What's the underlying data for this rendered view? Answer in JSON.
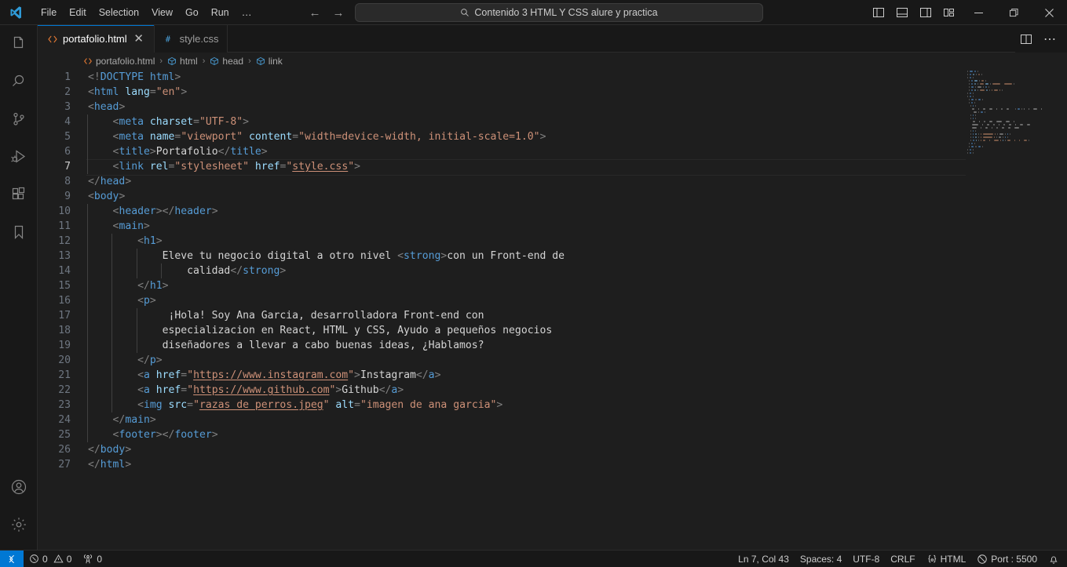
{
  "titlebar": {
    "logo_icon": "vscode-logo-icon",
    "menus": [
      "File",
      "Edit",
      "Selection",
      "View",
      "Go",
      "Run"
    ],
    "overflow_label": "…",
    "nav_back_icon": "arrow-left-icon",
    "nav_forward_icon": "arrow-right-icon",
    "command_center": {
      "search_icon": "search-icon",
      "text": "Contenido 3 HTML Y CSS alure y practica"
    },
    "layout_buttons": [
      {
        "name": "toggle-primary-sidebar-icon"
      },
      {
        "name": "toggle-panel-icon"
      },
      {
        "name": "toggle-secondary-sidebar-icon"
      },
      {
        "name": "customize-layout-icon"
      }
    ],
    "window_controls": [
      {
        "name": "minimize-button",
        "glyph": "─"
      },
      {
        "name": "maximize-button",
        "glyph": "❐"
      },
      {
        "name": "close-button",
        "glyph": "✕"
      }
    ]
  },
  "activitybar": {
    "items": [
      {
        "name": "explorer-icon",
        "label": "Explorer"
      },
      {
        "name": "search-icon",
        "label": "Search"
      },
      {
        "name": "source-control-icon",
        "label": "Source Control"
      },
      {
        "name": "run-and-debug-icon",
        "label": "Run and Debug"
      },
      {
        "name": "extensions-icon",
        "label": "Extensions"
      },
      {
        "name": "bookmarks-icon",
        "label": "Bookmarks"
      }
    ],
    "bottom": [
      {
        "name": "accounts-icon",
        "label": "Accounts"
      },
      {
        "name": "settings-gear-icon",
        "label": "Manage"
      }
    ]
  },
  "tabs": [
    {
      "label": "portafolio.html",
      "icon": "html-file-icon",
      "active": true,
      "close_glyph": "✕"
    },
    {
      "label": "style.css",
      "icon": "css-file-icon",
      "active": false
    }
  ],
  "tabbar_actions": [
    {
      "name": "split-editor-right-icon"
    },
    {
      "name": "more-actions-icon",
      "glyph": "⋯"
    }
  ],
  "breadcrumbs": [
    {
      "label": "portafolio.html",
      "icon": "html-file-icon"
    },
    {
      "label": "html",
      "icon": "symbol-field-icon"
    },
    {
      "label": "head",
      "icon": "symbol-field-icon"
    },
    {
      "label": "link",
      "icon": "symbol-field-icon"
    }
  ],
  "editor": {
    "current_line": 7,
    "first_line_number": 1,
    "lines": [
      {
        "n": 1,
        "indent": 0,
        "tokens": [
          {
            "c": "t-punc",
            "t": "<!"
          },
          {
            "c": "t-doctype",
            "t": "DOCTYPE"
          },
          {
            "c": "t-plain",
            "t": " "
          },
          {
            "c": "t-tag",
            "t": "html"
          },
          {
            "c": "t-punc",
            "t": ">"
          }
        ]
      },
      {
        "n": 2,
        "indent": 0,
        "tokens": [
          {
            "c": "t-punc",
            "t": "<"
          },
          {
            "c": "t-tag",
            "t": "html"
          },
          {
            "c": "t-plain",
            "t": " "
          },
          {
            "c": "t-attr",
            "t": "lang"
          },
          {
            "c": "t-punc",
            "t": "="
          },
          {
            "c": "t-str",
            "t": "\"en\""
          },
          {
            "c": "t-punc",
            "t": ">"
          }
        ]
      },
      {
        "n": 3,
        "indent": 0,
        "tokens": [
          {
            "c": "t-punc",
            "t": "<"
          },
          {
            "c": "t-tag",
            "t": "head"
          },
          {
            "c": "t-punc",
            "t": ">"
          }
        ]
      },
      {
        "n": 4,
        "indent": 1,
        "tokens": [
          {
            "c": "t-plain",
            "t": "    "
          },
          {
            "c": "t-punc",
            "t": "<"
          },
          {
            "c": "t-tag",
            "t": "meta"
          },
          {
            "c": "t-plain",
            "t": " "
          },
          {
            "c": "t-attr",
            "t": "charset"
          },
          {
            "c": "t-punc",
            "t": "="
          },
          {
            "c": "t-str",
            "t": "\"UTF-8\""
          },
          {
            "c": "t-punc",
            "t": ">"
          }
        ]
      },
      {
        "n": 5,
        "indent": 1,
        "tokens": [
          {
            "c": "t-plain",
            "t": "    "
          },
          {
            "c": "t-punc",
            "t": "<"
          },
          {
            "c": "t-tag",
            "t": "meta"
          },
          {
            "c": "t-plain",
            "t": " "
          },
          {
            "c": "t-attr",
            "t": "name"
          },
          {
            "c": "t-punc",
            "t": "="
          },
          {
            "c": "t-str",
            "t": "\"viewport\""
          },
          {
            "c": "t-plain",
            "t": " "
          },
          {
            "c": "t-attr",
            "t": "content"
          },
          {
            "c": "t-punc",
            "t": "="
          },
          {
            "c": "t-str",
            "t": "\"width=device-width, initial-scale=1.0\""
          },
          {
            "c": "t-punc",
            "t": ">"
          }
        ]
      },
      {
        "n": 6,
        "indent": 1,
        "tokens": [
          {
            "c": "t-plain",
            "t": "    "
          },
          {
            "c": "t-punc",
            "t": "<"
          },
          {
            "c": "t-tag",
            "t": "title"
          },
          {
            "c": "t-punc",
            "t": ">"
          },
          {
            "c": "t-plain",
            "t": "Portafolio"
          },
          {
            "c": "t-punc",
            "t": "</"
          },
          {
            "c": "t-tag",
            "t": "title"
          },
          {
            "c": "t-punc",
            "t": ">"
          }
        ]
      },
      {
        "n": 7,
        "indent": 1,
        "tokens": [
          {
            "c": "t-plain",
            "t": "    "
          },
          {
            "c": "t-punc",
            "t": "<"
          },
          {
            "c": "t-tag",
            "t": "link"
          },
          {
            "c": "t-plain",
            "t": " "
          },
          {
            "c": "t-attr",
            "t": "rel"
          },
          {
            "c": "t-punc",
            "t": "="
          },
          {
            "c": "t-str",
            "t": "\"stylesheet\""
          },
          {
            "c": "t-plain",
            "t": " "
          },
          {
            "c": "t-attr",
            "t": "href"
          },
          {
            "c": "t-punc",
            "t": "="
          },
          {
            "c": "t-str",
            "t": "\""
          },
          {
            "c": "t-link",
            "t": "style.css"
          },
          {
            "c": "t-str",
            "t": "\""
          },
          {
            "c": "t-punc",
            "t": ">"
          }
        ]
      },
      {
        "n": 8,
        "indent": 0,
        "tokens": [
          {
            "c": "t-punc",
            "t": "</"
          },
          {
            "c": "t-tag",
            "t": "head"
          },
          {
            "c": "t-punc",
            "t": ">"
          }
        ]
      },
      {
        "n": 9,
        "indent": 0,
        "tokens": [
          {
            "c": "t-punc",
            "t": "<"
          },
          {
            "c": "t-tag",
            "t": "body"
          },
          {
            "c": "t-punc",
            "t": ">"
          }
        ]
      },
      {
        "n": 10,
        "indent": 1,
        "tokens": [
          {
            "c": "t-plain",
            "t": "    "
          },
          {
            "c": "t-punc",
            "t": "<"
          },
          {
            "c": "t-tag",
            "t": "header"
          },
          {
            "c": "t-punc",
            "t": "></"
          },
          {
            "c": "t-tag",
            "t": "header"
          },
          {
            "c": "t-punc",
            "t": ">"
          }
        ]
      },
      {
        "n": 11,
        "indent": 1,
        "tokens": [
          {
            "c": "t-plain",
            "t": "    "
          },
          {
            "c": "t-punc",
            "t": "<"
          },
          {
            "c": "t-tag",
            "t": "main"
          },
          {
            "c": "t-punc",
            "t": ">"
          }
        ]
      },
      {
        "n": 12,
        "indent": 2,
        "tokens": [
          {
            "c": "t-plain",
            "t": "        "
          },
          {
            "c": "t-punc",
            "t": "<"
          },
          {
            "c": "t-tag",
            "t": "h1"
          },
          {
            "c": "t-punc",
            "t": ">"
          }
        ]
      },
      {
        "n": 13,
        "indent": 3,
        "tokens": [
          {
            "c": "t-plain",
            "t": "            Eleve tu negocio digital a otro nivel "
          },
          {
            "c": "t-punc",
            "t": "<"
          },
          {
            "c": "t-tag",
            "t": "strong"
          },
          {
            "c": "t-punc",
            "t": ">"
          },
          {
            "c": "t-plain",
            "t": "con un Front-end de"
          }
        ]
      },
      {
        "n": 14,
        "indent": 4,
        "tokens": [
          {
            "c": "t-plain",
            "t": "                calidad"
          },
          {
            "c": "t-punc",
            "t": "</"
          },
          {
            "c": "t-tag",
            "t": "strong"
          },
          {
            "c": "t-punc",
            "t": ">"
          }
        ]
      },
      {
        "n": 15,
        "indent": 2,
        "tokens": [
          {
            "c": "t-plain",
            "t": "        "
          },
          {
            "c": "t-punc",
            "t": "</"
          },
          {
            "c": "t-tag",
            "t": "h1"
          },
          {
            "c": "t-punc",
            "t": ">"
          }
        ]
      },
      {
        "n": 16,
        "indent": 2,
        "tokens": [
          {
            "c": "t-plain",
            "t": "        "
          },
          {
            "c": "t-punc",
            "t": "<"
          },
          {
            "c": "t-tag",
            "t": "p"
          },
          {
            "c": "t-punc",
            "t": ">"
          }
        ]
      },
      {
        "n": 17,
        "indent": 3,
        "tokens": [
          {
            "c": "t-plain",
            "t": "             ¡Hola! Soy Ana Garcia, desarrolladora Front-end con"
          }
        ]
      },
      {
        "n": 18,
        "indent": 3,
        "tokens": [
          {
            "c": "t-plain",
            "t": "            especializacion en React, HTML y CSS, Ayudo a pequeños negocios"
          }
        ]
      },
      {
        "n": 19,
        "indent": 3,
        "tokens": [
          {
            "c": "t-plain",
            "t": "            diseñadores a llevar a cabo buenas ideas, ¿Hablamos?"
          }
        ]
      },
      {
        "n": 20,
        "indent": 2,
        "tokens": [
          {
            "c": "t-plain",
            "t": "        "
          },
          {
            "c": "t-punc",
            "t": "</"
          },
          {
            "c": "t-tag",
            "t": "p"
          },
          {
            "c": "t-punc",
            "t": ">"
          }
        ]
      },
      {
        "n": 21,
        "indent": 2,
        "tokens": [
          {
            "c": "t-plain",
            "t": "        "
          },
          {
            "c": "t-punc",
            "t": "<"
          },
          {
            "c": "t-tag",
            "t": "a"
          },
          {
            "c": "t-plain",
            "t": " "
          },
          {
            "c": "t-attr",
            "t": "href"
          },
          {
            "c": "t-punc",
            "t": "="
          },
          {
            "c": "t-str",
            "t": "\""
          },
          {
            "c": "t-link",
            "t": "https://www.instagram.com"
          },
          {
            "c": "t-str",
            "t": "\""
          },
          {
            "c": "t-punc",
            "t": ">"
          },
          {
            "c": "t-plain",
            "t": "Instagram"
          },
          {
            "c": "t-punc",
            "t": "</"
          },
          {
            "c": "t-tag",
            "t": "a"
          },
          {
            "c": "t-punc",
            "t": ">"
          }
        ]
      },
      {
        "n": 22,
        "indent": 2,
        "tokens": [
          {
            "c": "t-plain",
            "t": "        "
          },
          {
            "c": "t-punc",
            "t": "<"
          },
          {
            "c": "t-tag",
            "t": "a"
          },
          {
            "c": "t-plain",
            "t": " "
          },
          {
            "c": "t-attr",
            "t": "href"
          },
          {
            "c": "t-punc",
            "t": "="
          },
          {
            "c": "t-str",
            "t": "\""
          },
          {
            "c": "t-link",
            "t": "https://www.github.com"
          },
          {
            "c": "t-str",
            "t": "\""
          },
          {
            "c": "t-punc",
            "t": ">"
          },
          {
            "c": "t-plain",
            "t": "Github"
          },
          {
            "c": "t-punc",
            "t": "</"
          },
          {
            "c": "t-tag",
            "t": "a"
          },
          {
            "c": "t-punc",
            "t": ">"
          }
        ]
      },
      {
        "n": 23,
        "indent": 2,
        "tokens": [
          {
            "c": "t-plain",
            "t": "        "
          },
          {
            "c": "t-punc",
            "t": "<"
          },
          {
            "c": "t-tag",
            "t": "img"
          },
          {
            "c": "t-plain",
            "t": " "
          },
          {
            "c": "t-attr",
            "t": "src"
          },
          {
            "c": "t-punc",
            "t": "="
          },
          {
            "c": "t-str",
            "t": "\""
          },
          {
            "c": "t-link",
            "t": "razas de perros.jpeg"
          },
          {
            "c": "t-str",
            "t": "\""
          },
          {
            "c": "t-plain",
            "t": " "
          },
          {
            "c": "t-attr",
            "t": "alt"
          },
          {
            "c": "t-punc",
            "t": "="
          },
          {
            "c": "t-str",
            "t": "\"imagen de ana garcia\""
          },
          {
            "c": "t-punc",
            "t": ">"
          }
        ]
      },
      {
        "n": 24,
        "indent": 1,
        "tokens": [
          {
            "c": "t-plain",
            "t": "    "
          },
          {
            "c": "t-punc",
            "t": "</"
          },
          {
            "c": "t-tag",
            "t": "main"
          },
          {
            "c": "t-punc",
            "t": ">"
          }
        ]
      },
      {
        "n": 25,
        "indent": 1,
        "tokens": [
          {
            "c": "t-plain",
            "t": "    "
          },
          {
            "c": "t-punc",
            "t": "<"
          },
          {
            "c": "t-tag",
            "t": "footer"
          },
          {
            "c": "t-punc",
            "t": "></"
          },
          {
            "c": "t-tag",
            "t": "footer"
          },
          {
            "c": "t-punc",
            "t": ">"
          }
        ]
      },
      {
        "n": 26,
        "indent": 0,
        "tokens": [
          {
            "c": "t-punc",
            "t": "</"
          },
          {
            "c": "t-tag",
            "t": "body"
          },
          {
            "c": "t-punc",
            "t": ">"
          }
        ]
      },
      {
        "n": 27,
        "indent": 0,
        "tokens": [
          {
            "c": "t-punc",
            "t": "</"
          },
          {
            "c": "t-tag",
            "t": "html"
          },
          {
            "c": "t-punc",
            "t": ">"
          }
        ]
      }
    ]
  },
  "statusbar": {
    "remote_icon": "remote-window-icon",
    "problems": {
      "error_icon": "error-circle-icon",
      "errors": "0",
      "warning_icon": "warning-triangle-icon",
      "warnings": "0"
    },
    "ports": {
      "icon": "radio-tower-icon",
      "count": "0"
    },
    "cursor": "Ln 7, Col 43",
    "indent": "Spaces: 4",
    "encoding": "UTF-8",
    "eol": "CRLF",
    "language": {
      "icon": "braces-icon",
      "label": "HTML"
    },
    "live_server": {
      "icon": "broadcast-off-icon",
      "label": "Port : 5500"
    },
    "notifications_icon": "bell-icon"
  },
  "colors": {
    "accent": "#0078d4",
    "editor_bg": "#1e1e1e",
    "chrome_bg": "#181818",
    "tag": "#569cd6",
    "attr": "#9cdcfe",
    "string": "#ce9178",
    "plain": "#d4d4d4",
    "punct": "#808080",
    "linenum": "#6e7681"
  }
}
